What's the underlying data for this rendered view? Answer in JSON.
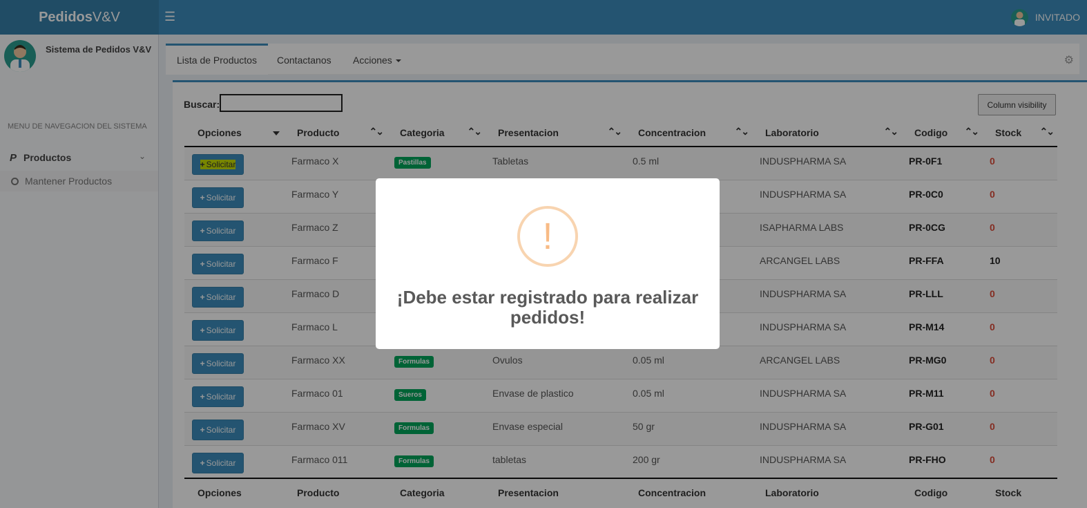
{
  "header": {
    "brand_bold": "Pedidos",
    "brand_rest": "V&V",
    "menu_icon": "hamburger-icon",
    "user_label": "INVITADO"
  },
  "sidebar": {
    "user_name": "Sistema de Pedidos V&V",
    "nav_header": "MENU DE NAVEGACION DEL SISTEMA",
    "items": [
      {
        "label": "Productos",
        "icon": "paypal-icon"
      }
    ],
    "subitems": [
      {
        "label": "Mantener Productos"
      }
    ]
  },
  "tabs": [
    {
      "label": "Lista de Productos",
      "active": true
    },
    {
      "label": "Contactanos"
    },
    {
      "label": "Acciones"
    }
  ],
  "search": {
    "label": "Buscar:",
    "value": ""
  },
  "column_visibility_label": "Column visibility",
  "table": {
    "columns": [
      "Opciones",
      "Producto",
      "Categoria",
      "Presentacion",
      "Concentracion",
      "Laboratorio",
      "Codigo",
      "Stock"
    ],
    "button_label": "Solicitar",
    "rows": [
      {
        "producto": "Farmaco X",
        "categoria": "Pastillas",
        "presentacion": "Tabletas",
        "concentracion": "0.5 ml",
        "laboratorio": "INDUSPHARMA SA",
        "codigo": "PR-0F1",
        "stock": "0"
      },
      {
        "producto": "Farmaco Y",
        "categoria": "",
        "presentacion": "",
        "concentracion": "",
        "laboratorio": "INDUSPHARMA SA",
        "codigo": "PR-0C0",
        "stock": "0"
      },
      {
        "producto": "Farmaco Z",
        "categoria": "",
        "presentacion": "",
        "concentracion": "",
        "laboratorio": "ISAPHARMA LABS",
        "codigo": "PR-0CG",
        "stock": "0"
      },
      {
        "producto": "Farmaco F",
        "categoria": "",
        "presentacion": "",
        "concentracion": "",
        "laboratorio": "ARCANGEL LABS",
        "codigo": "PR-FFA",
        "stock": "10"
      },
      {
        "producto": "Farmaco D",
        "categoria": "",
        "presentacion": "",
        "concentracion": "",
        "laboratorio": "INDUSPHARMA SA",
        "codigo": "PR-LLL",
        "stock": "0"
      },
      {
        "producto": "Farmaco L",
        "categoria": "",
        "presentacion": "",
        "concentracion": "",
        "laboratorio": "INDUSPHARMA SA",
        "codigo": "PR-M14",
        "stock": "0"
      },
      {
        "producto": "Farmaco XX",
        "categoria": "Formulas",
        "presentacion": "Ovulos",
        "concentracion": "0.05 ml",
        "laboratorio": "ARCANGEL LABS",
        "codigo": "PR-MG0",
        "stock": "0"
      },
      {
        "producto": "Farmaco 01",
        "categoria": "Sueros",
        "presentacion": "Envase de plastico",
        "concentracion": "0.05 ml",
        "laboratorio": "INDUSPHARMA SA",
        "codigo": "PR-M11",
        "stock": "0"
      },
      {
        "producto": "Farmaco XV",
        "categoria": "Formulas",
        "presentacion": "Envase especial",
        "concentracion": "50 gr",
        "laboratorio": "INDUSPHARMA SA",
        "codigo": "PR-G01",
        "stock": "0"
      },
      {
        "producto": "Farmaco 011",
        "categoria": "Formulas",
        "presentacion": "tabletas",
        "concentracion": "200 gr",
        "laboratorio": "INDUSPHARMA SA",
        "codigo": "PR-FHO",
        "stock": "0"
      }
    ]
  },
  "modal": {
    "icon": "warning-icon",
    "title": "¡Debe estar registrado para realizar pedidos!"
  },
  "colors": {
    "primary": "#3c8dbc",
    "success": "#00a65a",
    "danger": "#dd4b39",
    "warning": "#f8bb86"
  }
}
